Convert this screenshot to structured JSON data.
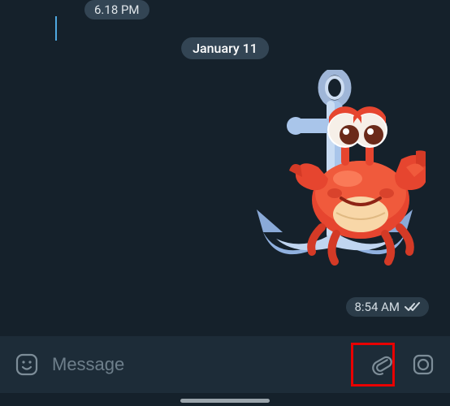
{
  "chat": {
    "prev_time": "6.18 PM",
    "date_divider": "January 11",
    "sticker_msg": {
      "time": "8:54 AM",
      "read": true
    }
  },
  "composer": {
    "placeholder": "Message",
    "value": ""
  },
  "icons": {
    "sticker": "sticker-icon",
    "attach": "paperclip-icon",
    "camera": "camera-icon"
  }
}
